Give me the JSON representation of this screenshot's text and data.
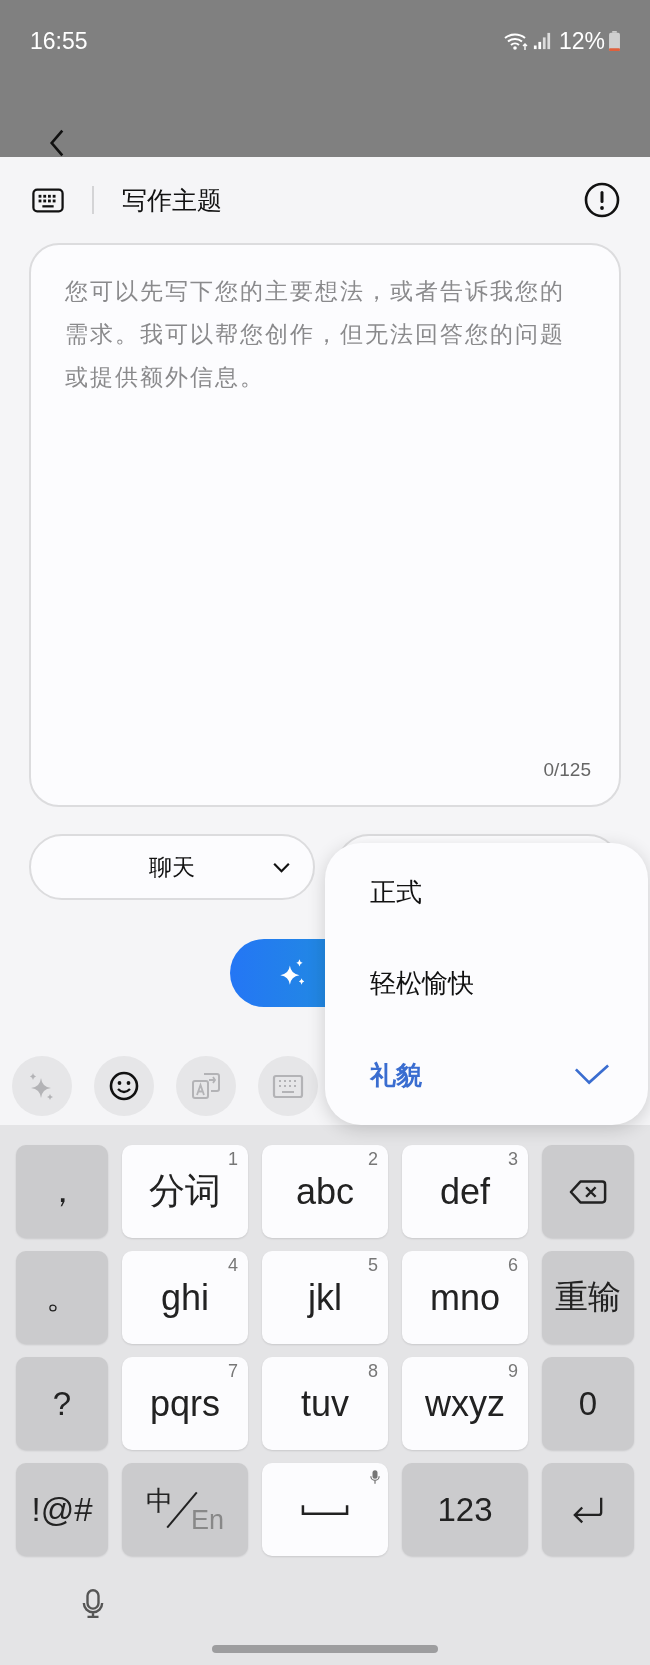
{
  "status_bar": {
    "time": "16:55",
    "battery": "12%"
  },
  "sheet": {
    "title": "写作主题"
  },
  "input": {
    "placeholder": "您可以先写下您的主要想法，或者告诉我您的需求。我可以帮您创作，但无法回答您的问题或提供额外信息。",
    "counter": "0/125"
  },
  "style_dropdown": {
    "label": "聊天"
  },
  "tone_dropdown": {
    "expanded": true,
    "options": [
      {
        "label": "正式",
        "selected": false
      },
      {
        "label": "轻松愉快",
        "selected": false
      },
      {
        "label": "礼貌",
        "selected": true
      }
    ]
  },
  "toolbar": [
    {
      "disabled": true
    },
    {
      "disabled": false
    },
    {
      "disabled": true
    },
    {
      "disabled": true
    }
  ],
  "keyboard": {
    "rows": [
      [
        {
          "kind": "symbol",
          "label": "，"
        },
        {
          "kind": "letter",
          "label": "分词",
          "digit": "1"
        },
        {
          "kind": "letter",
          "label": "abc",
          "digit": "2"
        },
        {
          "kind": "letter",
          "label": "def",
          "digit": "3"
        },
        {
          "kind": "backspace"
        }
      ],
      [
        {
          "kind": "symbol",
          "label": "。"
        },
        {
          "kind": "letter",
          "label": "ghi",
          "digit": "4"
        },
        {
          "kind": "letter",
          "label": "jkl",
          "digit": "5"
        },
        {
          "kind": "letter",
          "label": "mno",
          "digit": "6"
        },
        {
          "kind": "symbol",
          "label": "重输"
        }
      ],
      [
        {
          "kind": "symbol",
          "label": "?"
        },
        {
          "kind": "letter",
          "label": "pqrs",
          "digit": "7"
        },
        {
          "kind": "letter",
          "label": "tuv",
          "digit": "8"
        },
        {
          "kind": "letter",
          "label": "wxyz",
          "digit": "9"
        },
        {
          "kind": "symbol",
          "label": "0"
        }
      ],
      [
        {
          "kind": "symbol",
          "label": "!@#"
        },
        {
          "kind": "lang",
          "label": "中",
          "alt": "En"
        },
        {
          "kind": "space"
        },
        {
          "kind": "symbol",
          "label": "123"
        },
        {
          "kind": "enter"
        }
      ]
    ]
  }
}
